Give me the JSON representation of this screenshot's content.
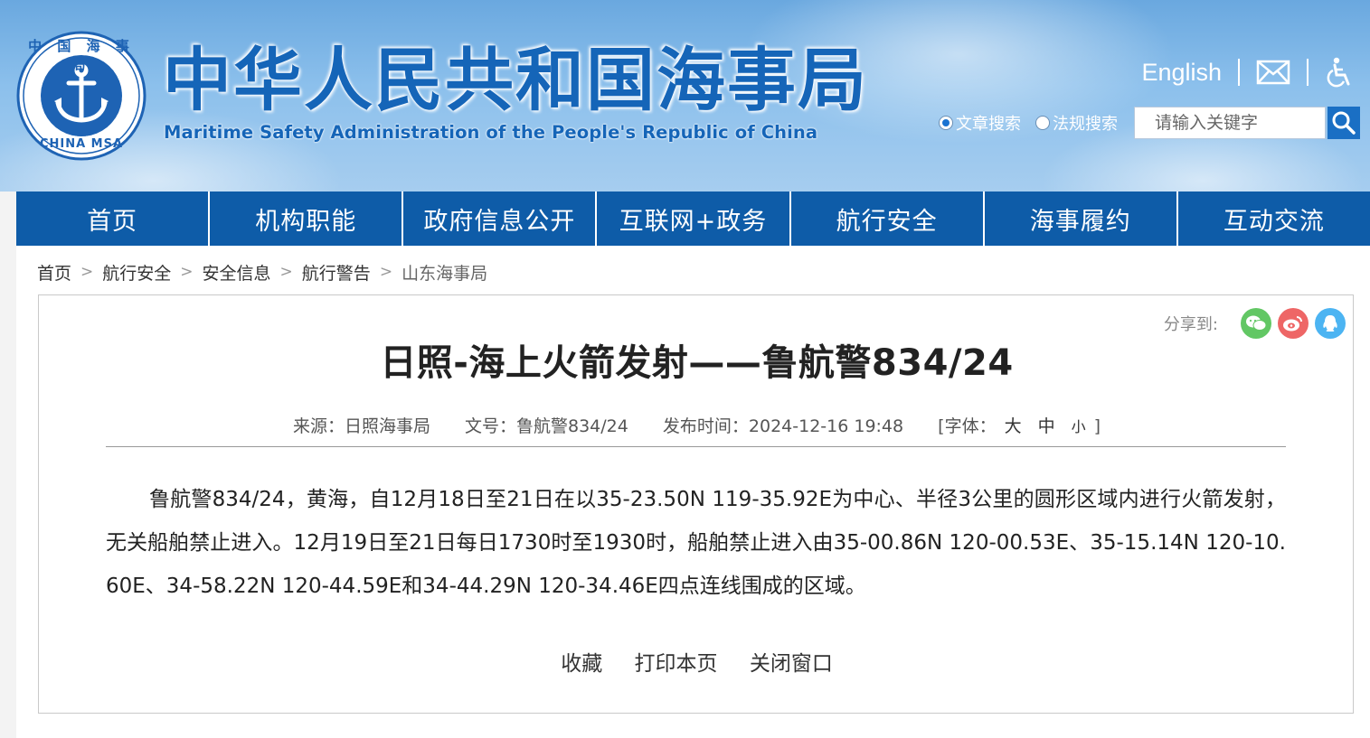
{
  "header": {
    "title_cn": "中华人民共和国海事局",
    "title_en": "Maritime Safety Administration of the People's Republic of China",
    "emblem": {
      "top_text": "中 国 海 事 局",
      "bottom_text": "CHINA MSA"
    },
    "links": {
      "english": "English",
      "mail_icon": "mail-icon",
      "accessibility_icon": "accessibility-icon"
    },
    "search": {
      "option_article": "文章搜索",
      "option_law": "法规搜索",
      "selected": "article",
      "placeholder": "请输入关键字"
    }
  },
  "nav": {
    "items": [
      "首页",
      "机构职能",
      "政府信息公开",
      "互联网+政务",
      "航行安全",
      "海事履约",
      "互动交流"
    ]
  },
  "breadcrumb": {
    "items": [
      "首页",
      "航行安全",
      "安全信息",
      "航行警告",
      "山东海事局"
    ],
    "separator": ">"
  },
  "article": {
    "share_label": "分享到:",
    "title": "日照-海上火箭发射——鲁航警834/24",
    "meta": {
      "source": "来源：日照海事局",
      "doc_no": "文号：鲁航警834/24",
      "published": "发布时间：2024-12-16 19:48",
      "font_label": "[字体：",
      "font_large": "大",
      "font_medium": "中",
      "font_small": "小",
      "font_close": "]"
    },
    "body": "鲁航警834/24，黄海，自12月18日至21日在以35-23.50N 119-35.92E为中心、半径3公里的圆形区域内进行火箭发射，无关船舶禁止进入。12月19日至21日每日1730时至1930时，船舶禁止进入由35-00.86N 120-00.53E、35-15.14N 120-10.60E、34-58.22N 120-44.59E和34-44.29N 120-34.46E四点连线围成的区域。",
    "actions": {
      "favorite": "收藏",
      "print": "打印本页",
      "close": "关闭窗口"
    }
  },
  "colors": {
    "brand_blue": "#1565b8",
    "nav_blue": "#0e5ca8",
    "wechat_green": "#62c764",
    "weibo_red": "#ee6666",
    "qq_blue": "#4cb4f2"
  }
}
